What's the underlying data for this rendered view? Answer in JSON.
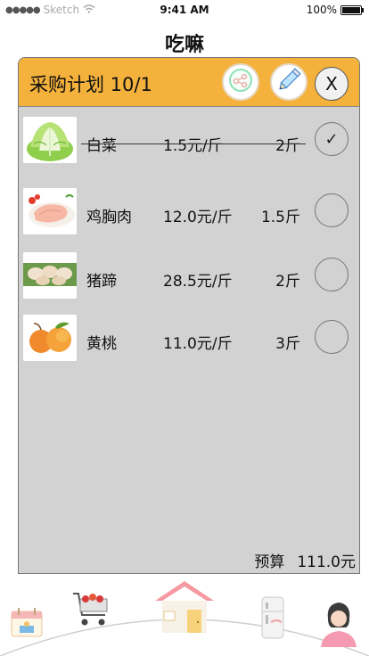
{
  "status_bar": {
    "carrier": "Sketch",
    "time": "9:41 AM",
    "battery_text": "100%",
    "battery_level": 1.0,
    "signal_dots": "●●●●●",
    "wifi_icon": "wifi-icon"
  },
  "app": {
    "title": "吃嘛"
  },
  "panel": {
    "title": "采购计划 10/1",
    "share_icon": "share-icon",
    "edit_icon": "pencil-icon",
    "close_label": "X",
    "header_color": "#f4b23c",
    "panel_color": "#d2d2d2"
  },
  "items": [
    {
      "name": "白菜",
      "price": "1.5元/斤",
      "qty": "2斤",
      "checked": true,
      "check_mark": "✓",
      "image": "cabbage-image"
    },
    {
      "name": "鸡胸肉",
      "price": "12.0元/斤",
      "qty": "1.5斤",
      "checked": false,
      "check_mark": "",
      "image": "chicken-breast-image"
    },
    {
      "name": "猪蹄",
      "price": "28.5元/斤",
      "qty": "2斤",
      "checked": false,
      "check_mark": "",
      "image": "pig-trotter-image"
    },
    {
      "name": "黄桃",
      "price": "11.0元/斤",
      "qty": "3斤",
      "checked": false,
      "check_mark": "",
      "image": "yellow-peach-image"
    }
  ],
  "budget": {
    "label": "预算",
    "value": "111.0元"
  },
  "tabbar": {
    "items": [
      {
        "name": "calendar",
        "icon": "calendar-icon"
      },
      {
        "name": "cart",
        "icon": "shopping-cart-icon",
        "active": true
      },
      {
        "name": "home",
        "icon": "home-icon"
      },
      {
        "name": "fridge",
        "icon": "fridge-icon"
      },
      {
        "name": "profile",
        "icon": "user-icon"
      }
    ]
  }
}
